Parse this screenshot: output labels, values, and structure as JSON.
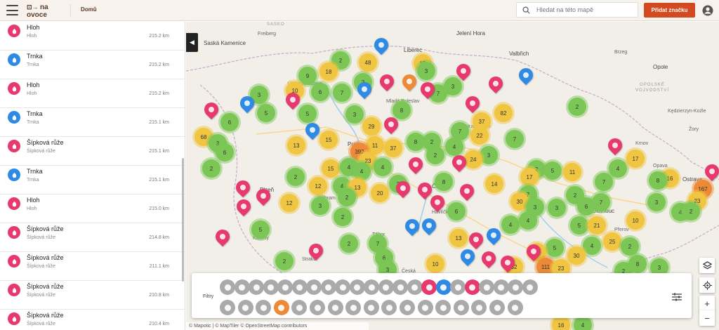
{
  "topbar": {
    "logo_text": "na ovoce",
    "nav_home": "Domů",
    "search_placeholder": "Hledat na této mapě",
    "add_button": "Přidat značku"
  },
  "list": [
    {
      "name": "Hloh",
      "sub": "Hloh",
      "dist": "215.2 km",
      "color": "#e8396e"
    },
    {
      "name": "Trnka",
      "sub": "Trnka",
      "dist": "215.2 km",
      "color": "#2f8ae5"
    },
    {
      "name": "Hloh",
      "sub": "Hloh",
      "dist": "215.2 km",
      "color": "#e8396e"
    },
    {
      "name": "Trnka",
      "sub": "Trnka",
      "dist": "215.1 km",
      "color": "#2f8ae5"
    },
    {
      "name": "Šípková růže",
      "sub": "Šípková růže",
      "dist": "215.1 km",
      "color": "#e8396e"
    },
    {
      "name": "Trnka",
      "sub": "Trnka",
      "dist": "215.1 km",
      "color": "#2f8ae5"
    },
    {
      "name": "Hloh",
      "sub": "Hloh",
      "dist": "215.0 km",
      "color": "#e8396e"
    },
    {
      "name": "Šípková růže",
      "sub": "Šípková růže",
      "dist": "214.8 km",
      "color": "#e8396e"
    },
    {
      "name": "Šípková růže",
      "sub": "Šípková růže",
      "dist": "211.1 km",
      "color": "#e8396e"
    },
    {
      "name": "Šípková růže",
      "sub": "Šípková růže",
      "dist": "210.8 km",
      "color": "#e8396e"
    },
    {
      "name": "Šípková růže",
      "sub": "Šípková růže",
      "dist": "210.4 km",
      "color": "#e8396e"
    }
  ],
  "map_labels": {
    "saska_kamenice": "Saská Kamenice",
    "freiberg": "Freiberg",
    "jelenia_gora": "Jelení Hora",
    "walbrzych": "Valbřich",
    "opole": "Opole",
    "opolske_vojvodstvi": "OPOLSKÉ\nVOJVODSTVÍ",
    "kedzierzyn": "Kędzierzyn-Koźle",
    "ostrava": "Ostrava",
    "liberec": "Liberec",
    "mlada_boleslav": "Mladá Boleslav",
    "praha": "Praha",
    "pribram": "Příbram",
    "klatovy": "Klatovy",
    "havlickuv_brod": "Havlíčkův Brod",
    "olomouc": "Olomouc",
    "prerov": "Přerov",
    "sasko": "SASKO",
    "opava": "Opava",
    "strakonice": "Strako",
    "tabor": "Tábor",
    "hradec": "Hradec",
    "usti": "Ústí nad Labem",
    "kralove": "Králové",
    "ceske": "České",
    "plzen": "Plzeň",
    "brzeg": "Brzeg",
    "ceska": "Česká",
    "zory": "Žory",
    "krnov": "Krnov"
  },
  "filters": {
    "label": "Filtry"
  },
  "attribution": "© Mapotic | © MapTiler © OpenStreetMap contributors",
  "colors": {
    "accent": "#d44a20",
    "pink": "#e8396e",
    "blue": "#2f8ae5",
    "green": "#7bc655",
    "yellow": "#f0c542",
    "orange": "#ec8a38"
  }
}
